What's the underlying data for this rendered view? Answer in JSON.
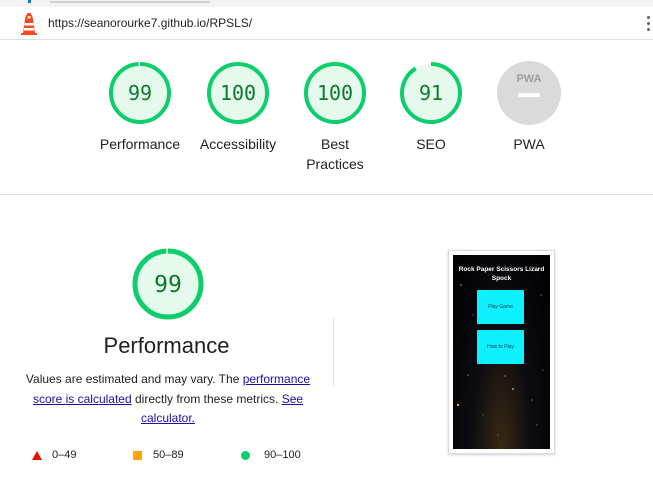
{
  "browser": {
    "url": "https://seanorourke7.github.io/RPSLS/"
  },
  "categories": [
    {
      "id": "performance",
      "label": "Performance",
      "score": 99,
      "fraction": 0.99
    },
    {
      "id": "accessibility",
      "label": "Accessibility",
      "score": 100,
      "fraction": 1.0
    },
    {
      "id": "best-practices",
      "label": "Best Practices",
      "score": 100,
      "fraction": 1.0
    },
    {
      "id": "seo",
      "label": "SEO",
      "score": 91,
      "fraction": 0.91
    },
    {
      "id": "pwa",
      "label": "PWA",
      "score": null,
      "badge": "PWA"
    }
  ],
  "performance": {
    "score": 99,
    "fraction": 0.99,
    "title": "Performance",
    "desc_prefix": "Values are estimated and may vary. The ",
    "desc_link1": "performance score is calculated",
    "desc_middle": " directly from these metrics. ",
    "desc_link2": "See calculator."
  },
  "legend": [
    {
      "range": "0–49",
      "shape": "triangle",
      "color": "#eb0f00"
    },
    {
      "range": "50–89",
      "shape": "square",
      "color": "#ffa400"
    },
    {
      "range": "90–100",
      "shape": "circle",
      "color": "#0cce6b"
    }
  ],
  "screenshot": {
    "title": "Rock Paper Scissors Lizard Spock",
    "button1": "Play Game",
    "button2": "How to Play"
  },
  "colors": {
    "pass_ring": "#0cce6b",
    "pass_fill": "#e5f9ec",
    "pass_text": "#0c7a2c",
    "pwa_gray": "#dadada",
    "link": "#1a0dab"
  }
}
